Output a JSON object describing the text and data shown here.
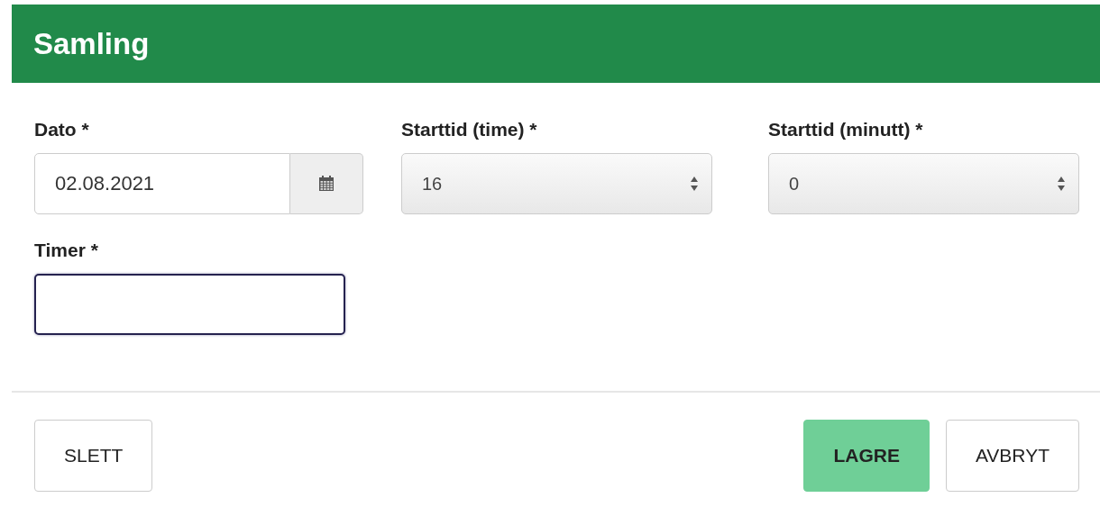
{
  "header": {
    "title": "Samling"
  },
  "fields": [
    {
      "kind": "date",
      "label": "Dato *",
      "value": "02.08.2021",
      "focused": false
    },
    {
      "kind": "select",
      "label": "Starttid (time) *",
      "value": "16",
      "focused": false
    },
    {
      "kind": "select",
      "label": "Starttid (minutt) *",
      "value": "0",
      "focused": false
    },
    {
      "kind": "text",
      "label": "Timer *",
      "focused": true
    }
  ],
  "footer": {
    "left_buttons": [
      {
        "label": "SLETT"
      }
    ],
    "right_buttons": [
      {
        "label": "LAGRE",
        "kind": "primary"
      },
      {
        "label": "AVBRYT",
        "kind": "default"
      }
    ]
  }
}
